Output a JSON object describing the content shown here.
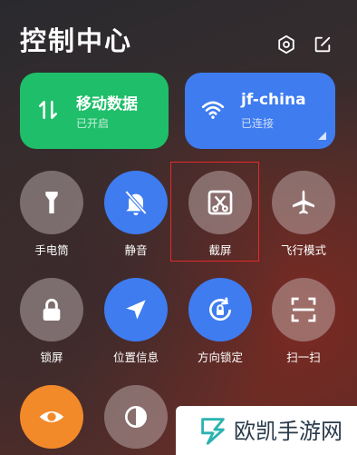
{
  "header": {
    "title": "控制中心",
    "icons": [
      "settings-icon",
      "edit-icon"
    ]
  },
  "tiles": [
    {
      "title": "移动数据",
      "status": "已开启",
      "icon": "mobile-data-icon",
      "color": "#1fbe6a"
    },
    {
      "title": "jf-china",
      "status": "已连接",
      "icon": "wifi-icon",
      "color": "#3e7cf0"
    }
  ],
  "toggles": [
    {
      "label": "手电筒",
      "icon": "flashlight-icon",
      "active": false
    },
    {
      "label": "静音",
      "icon": "mute-bell-icon",
      "active": true
    },
    {
      "label": "截屏",
      "icon": "screenshot-icon",
      "active": false
    },
    {
      "label": "飞行模式",
      "icon": "airplane-icon",
      "active": false
    },
    {
      "label": "锁屏",
      "icon": "lock-icon",
      "active": false
    },
    {
      "label": "位置信息",
      "icon": "location-icon",
      "active": true
    },
    {
      "label": "方向锁定",
      "icon": "rotation-lock-icon",
      "active": true
    },
    {
      "label": "扫一扫",
      "icon": "scan-icon",
      "active": false
    }
  ],
  "bottom_toggles": [
    {
      "icon": "eye-icon",
      "color": "#f28a2a"
    },
    {
      "icon": "contrast-icon",
      "color": "gray"
    }
  ],
  "watermark": {
    "text": "欧凯手游网"
  }
}
